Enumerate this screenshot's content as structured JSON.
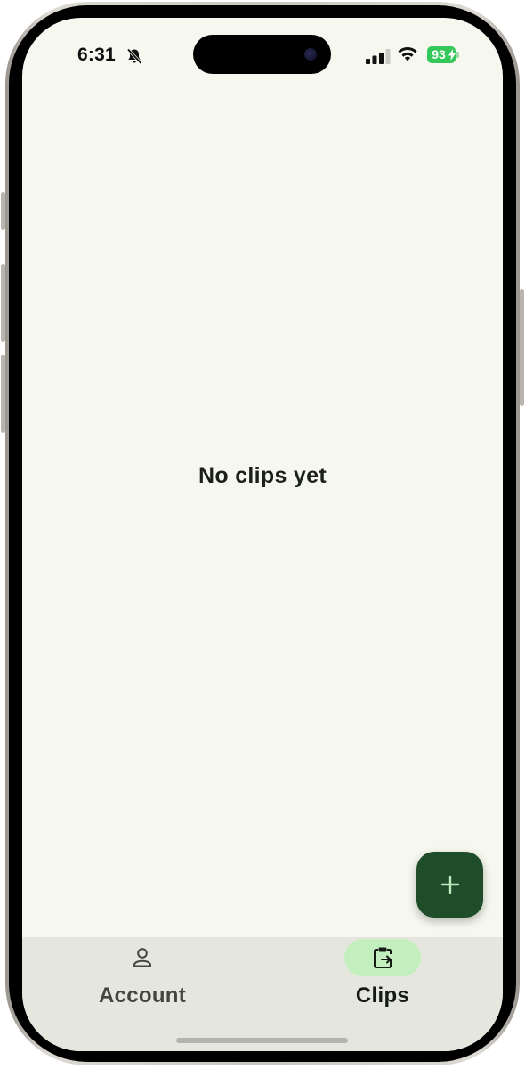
{
  "status_bar": {
    "time": "6:31",
    "battery": "93",
    "icons": [
      "bell-slash-icon",
      "signal-icon",
      "wifi-icon",
      "battery-charging-icon"
    ]
  },
  "main": {
    "empty_message": "No clips yet"
  },
  "fab": {
    "icon": "plus-icon"
  },
  "nav": {
    "items": [
      {
        "label": "Account",
        "icon": "person-icon",
        "selected": false
      },
      {
        "label": "Clips",
        "icon": "clipboard-icon",
        "selected": true
      }
    ]
  },
  "colors": {
    "background": "#f6f8ef",
    "fab": "#1f4d2a",
    "fab_icon": "#bfe9bc",
    "nav_background": "#e5e7df",
    "nav_selected_pill": "#c3efbf",
    "text": "#1b2118",
    "battery": "#34c759"
  }
}
